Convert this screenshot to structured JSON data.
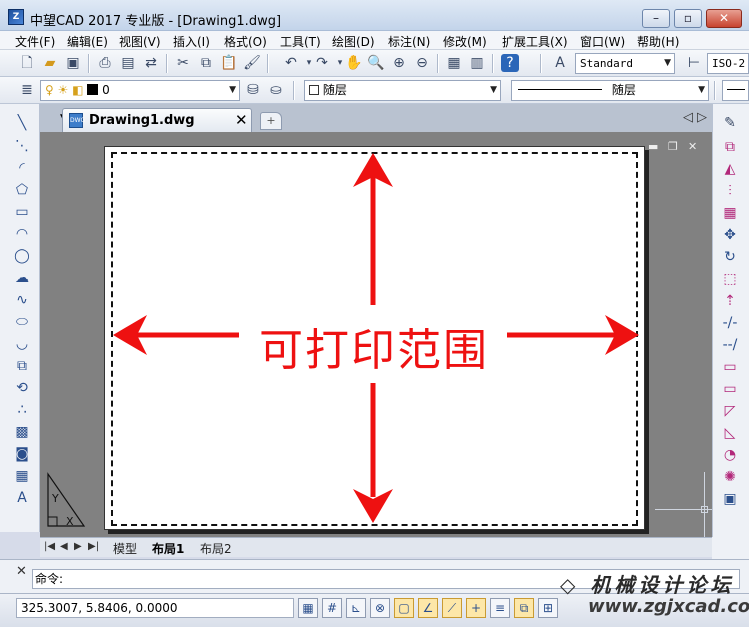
{
  "window": {
    "title": "中望CAD 2017 专业版 - [Drawing1.dwg]",
    "minimize_glyph": "▭",
    "maximize_glyph": "▢",
    "close_glyph": "✕"
  },
  "menu": [
    "文件(F)",
    "编辑(E)",
    "视图(V)",
    "插入(I)",
    "格式(O)",
    "工具(T)",
    "绘图(D)",
    "标注(N)",
    "修改(M)",
    "扩展工具(X)",
    "窗口(W)",
    "帮助(H)"
  ],
  "toolbar": {
    "text_style": "Standard",
    "dim_style": "ISO-2",
    "layer_value": "0",
    "color_value": "随层",
    "linetype_value": "随层"
  },
  "doc_tab": {
    "icon_text": "DWG",
    "title": "Drawing1.dwg",
    "close_glyph": "✕"
  },
  "canvas": {
    "printable_label": "可打印范围",
    "label_color": "#ee1111"
  },
  "layout_tabs": {
    "model": "模型",
    "layout1": "布局1",
    "layout2": "布局2"
  },
  "command": {
    "prompt": "命令:"
  },
  "status": {
    "coordinates": "325.3007, 5.8406, 0.0000"
  },
  "watermark": {
    "logo_text": "机械设计论坛",
    "url": "www.zgjxcad.com"
  },
  "icons": {
    "left": [
      "line-icon",
      "polyline-icon",
      "arc-icon",
      "polygon-icon",
      "rectangle-icon",
      "arc2-icon",
      "circle-icon",
      "cloud-icon",
      "spline-icon",
      "ellipse-icon",
      "ellipse-arc-icon",
      "insert-block-icon",
      "make-block-icon",
      "point-icon",
      "hatch-icon",
      "region-icon",
      "table-icon",
      "mtext-icon"
    ],
    "right": [
      "erase-icon",
      "copy-icon",
      "mirror-icon",
      "offset-icon",
      "array-icon",
      "move-icon",
      "rotate-icon",
      "scale-icon",
      "stretch-icon",
      "trim-icon",
      "extend-icon",
      "break-icon",
      "join-icon",
      "chamfer-icon",
      "fillet-icon",
      "explode-icon",
      "properties-icon"
    ]
  }
}
